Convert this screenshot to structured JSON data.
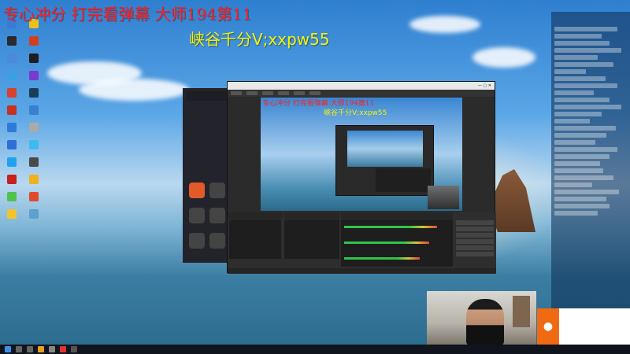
{
  "overlay": {
    "headline": "专心冲分 打完看弹幕 大师194第11",
    "subline": "峡谷千分V;xxpw55"
  },
  "desktop": {
    "icons": [
      {
        "color": "#3a7bd5"
      },
      {
        "color": "#e8c020"
      },
      {
        "color": "#2a2a2a"
      },
      {
        "color": "#d04020"
      },
      {
        "color": "#4a8ad8"
      },
      {
        "color": "#1e1e1e"
      },
      {
        "color": "#3aa0e0"
      },
      {
        "color": "#7a3ad0"
      },
      {
        "color": "#d84030"
      },
      {
        "color": "#1a3d5a"
      },
      {
        "color": "#c83020"
      },
      {
        "color": "#3a80d0"
      },
      {
        "color": "#2e7ad8"
      },
      {
        "color": "#aaaaaa"
      },
      {
        "color": "#2d6fd6"
      },
      {
        "color": "#3dbbf0"
      },
      {
        "color": "#1fa2f0"
      },
      {
        "color": "#4a4a4a"
      },
      {
        "color": "#c81f1f"
      },
      {
        "color": "#f0b020"
      },
      {
        "color": "#4fc24f"
      },
      {
        "color": "#e04a2a"
      },
      {
        "color": "#f2c32a"
      },
      {
        "color": "#5aa0d0"
      }
    ]
  },
  "obs": {
    "menu_items": [
      "",
      "",
      "",
      "",
      "",
      ""
    ]
  },
  "notification": {
    "icon": "broadcast-icon"
  },
  "colors": {
    "overlay_red": "#ff2020",
    "overlay_yellow": "#f2f20a",
    "obs_bg": "#2b2b2b",
    "notif_accent": "#f06a14",
    "taskbar": "#10141c"
  }
}
